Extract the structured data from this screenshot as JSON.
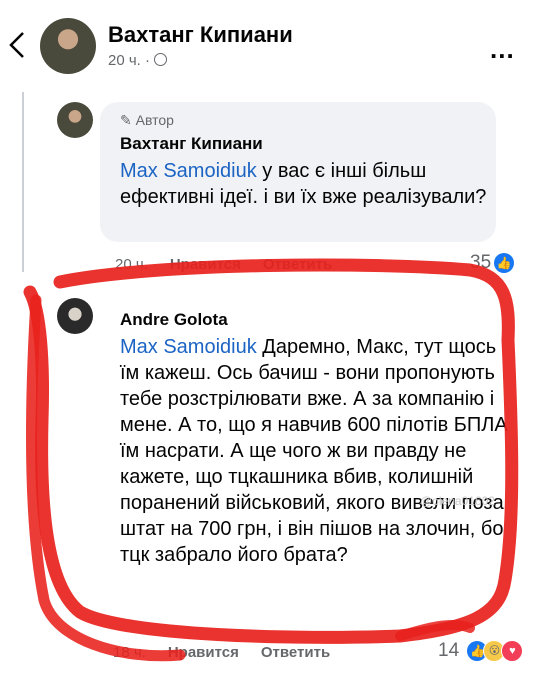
{
  "header": {
    "name": "Вахтанг Кипиани",
    "time": "20 ч. ·",
    "more": "..."
  },
  "comment1": {
    "author_badge": "Автор",
    "name": "Вахтанг Кипиани",
    "mention": "Max Samoidiuk",
    "text": " у вас є інші більш ефективні ідеї. і ви їх вже реалізували?",
    "time": "20 ч.",
    "like": "Нравится",
    "reply": "Ответить",
    "reactions": "35"
  },
  "comment2": {
    "name": "Andre Golota",
    "mention": "Max Samoidiuk",
    "text": " Даремно, Макс, тут щось їм кажеш. Ось бачиш - вони пропонують тебе розстрілювати вже. А за компанію і мене. А то, що я навчив 600 пілотів БПЛА їм насрати. А ще чого ж ви правду не кажете, що тцкашника вбив, колишній поранений військовий, якого вивели поза штат на 700 грн, і він пішов на злочин, бо тцк забрало його брата?",
    "time": "18 ч.",
    "like": "Нравится",
    "reply": "Ответить",
    "reactions": "14"
  },
  "watermark": "@olena01602",
  "colors": {
    "mention": "#1c64c4",
    "markup": "#e8211c",
    "like_blue": "#1877f2"
  },
  "icons": [
    "back-chevron-icon",
    "globe-icon",
    "pencil-icon",
    "like-reaction-icon",
    "wow-reaction-icon",
    "heart-reaction-icon"
  ]
}
